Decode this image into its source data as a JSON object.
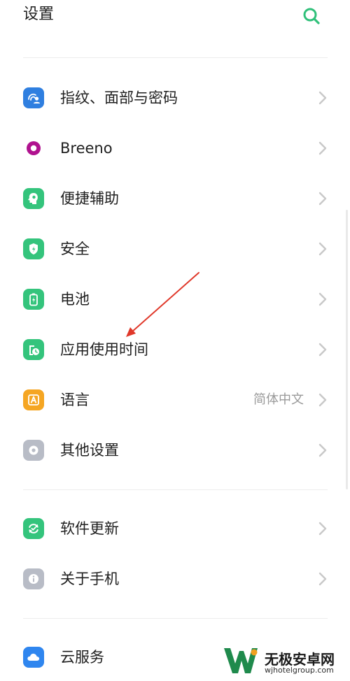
{
  "header": {
    "title": "设置"
  },
  "colors": {
    "accent": "#30c07a",
    "chevron": "#c8c8c8",
    "fingerprint": "#2f7fe0",
    "breeno": "#b0128f",
    "green": "#34c47c",
    "language": "#f5a623",
    "other": "#b8bcc6",
    "about": "#b8bcc6",
    "cloud": "#2f86ef",
    "arrow": "#e0382a"
  },
  "rows": [
    {
      "label": "指纹、面部与密码",
      "icon": "fingerprint-face-icon"
    },
    {
      "label": "Breeno",
      "icon": "breeno-icon"
    },
    {
      "label": "便捷辅助",
      "icon": "assist-icon"
    },
    {
      "label": "安全",
      "icon": "shield-icon"
    },
    {
      "label": "电池",
      "icon": "battery-icon"
    },
    {
      "label": "应用使用时间",
      "icon": "screen-time-icon"
    },
    {
      "label": "语言",
      "icon": "language-icon",
      "value": "简体中文"
    },
    {
      "label": "其他设置",
      "icon": "other-settings-icon"
    },
    {
      "label": "软件更新",
      "icon": "update-icon"
    },
    {
      "label": "关于手机",
      "icon": "info-icon"
    },
    {
      "label": "云服务",
      "icon": "cloud-icon"
    }
  ],
  "watermark": {
    "brand": "无极安卓网",
    "url": "wjhotelgroup.com"
  }
}
